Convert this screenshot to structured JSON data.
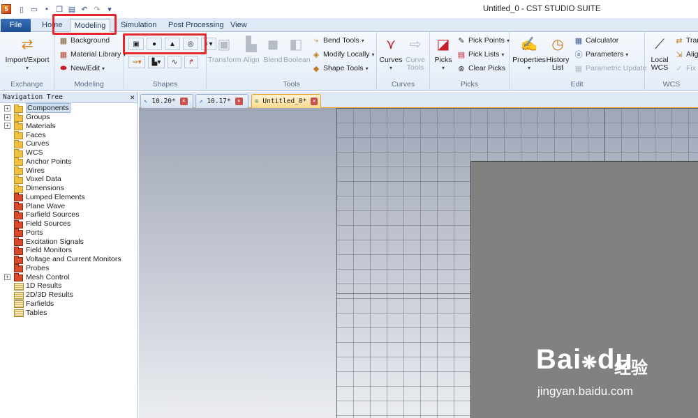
{
  "window": {
    "title": "Untitled_0 - CST STUDIO SUITE"
  },
  "ribbon_tabs": {
    "file": "File",
    "home": "Home",
    "modeling": "Modeling",
    "simulation": "Simulation",
    "post": "Post Processing",
    "view": "View"
  },
  "ribbon": {
    "exchange": {
      "label": "Exchange",
      "import_export": "Import/Export"
    },
    "modeling": {
      "label": "Modeling",
      "background": "Background",
      "material_library": "Material Library",
      "new_edit": "New/Edit"
    },
    "shapes": {
      "label": "Shapes"
    },
    "tools": {
      "label": "Tools",
      "transform": "Transform",
      "align": "Align",
      "blend": "Blend",
      "boolean": "Boolean",
      "bend_tools": "Bend Tools",
      "modify_locally": "Modify Locally",
      "shape_tools": "Shape Tools"
    },
    "curves": {
      "label": "Curves",
      "curves": "Curves",
      "curve_tools_1": "Curve",
      "curve_tools_2": "Tools"
    },
    "picks": {
      "label": "Picks",
      "picks": "Picks",
      "pick_points": "Pick Points",
      "pick_lists": "Pick Lists",
      "clear_picks": "Clear Picks"
    },
    "edit": {
      "label": "Edit",
      "properties": "Properties",
      "history_1": "History",
      "history_2": "List",
      "calculator": "Calculator",
      "parameters": "Parameters",
      "parametric_update": "Parametric Update"
    },
    "wcs": {
      "label": "WCS",
      "local_1": "Local",
      "local_2": "WCS",
      "transform": "Tran",
      "align": "Alig",
      "fix": "Fix V"
    }
  },
  "nav": {
    "title": "Navigation Tree",
    "items": [
      {
        "label": "Components",
        "expandable": true,
        "icon": "folder",
        "selected": true
      },
      {
        "label": "Groups",
        "expandable": true,
        "icon": "folder"
      },
      {
        "label": "Materials",
        "expandable": true,
        "icon": "folder"
      },
      {
        "label": "Faces",
        "expandable": false,
        "icon": "folder"
      },
      {
        "label": "Curves",
        "expandable": false,
        "icon": "folder"
      },
      {
        "label": "WCS",
        "expandable": false,
        "icon": "folder"
      },
      {
        "label": "Anchor Points",
        "expandable": false,
        "icon": "folder"
      },
      {
        "label": "Wires",
        "expandable": false,
        "icon": "folder"
      },
      {
        "label": "Voxel Data",
        "expandable": false,
        "icon": "folder"
      },
      {
        "label": "Dimensions",
        "expandable": false,
        "icon": "folder"
      },
      {
        "label": "Lumped Elements",
        "expandable": false,
        "icon": "red"
      },
      {
        "label": "Plane Wave",
        "expandable": false,
        "icon": "red"
      },
      {
        "label": "Farfield Sources",
        "expandable": false,
        "icon": "red"
      },
      {
        "label": "Field Sources",
        "expandable": false,
        "icon": "red"
      },
      {
        "label": "Ports",
        "expandable": false,
        "icon": "red"
      },
      {
        "label": "Excitation Signals",
        "expandable": false,
        "icon": "red"
      },
      {
        "label": "Field Monitors",
        "expandable": false,
        "icon": "red"
      },
      {
        "label": "Voltage and Current Monitors",
        "expandable": false,
        "icon": "red"
      },
      {
        "label": "Probes",
        "expandable": false,
        "icon": "red"
      },
      {
        "label": "Mesh Control",
        "expandable": true,
        "icon": "red"
      },
      {
        "label": "1D Results",
        "expandable": false,
        "icon": "table"
      },
      {
        "label": "2D/3D Results",
        "expandable": false,
        "icon": "table"
      },
      {
        "label": "Farfields",
        "expandable": false,
        "icon": "table"
      },
      {
        "label": "Tables",
        "expandable": false,
        "icon": "table"
      }
    ]
  },
  "doc_tabs": [
    {
      "label": "10.20*",
      "active": false
    },
    {
      "label": "10.17*",
      "active": false
    },
    {
      "label": "Untitled_0*",
      "active": true
    }
  ],
  "watermark": {
    "logo": "Bai",
    "logo2": "du",
    "cn": "经验",
    "url": "jingyan.baidu.com"
  },
  "colors": {
    "highlight_box": "#e5262a",
    "active_tab": "#e8a22a"
  }
}
